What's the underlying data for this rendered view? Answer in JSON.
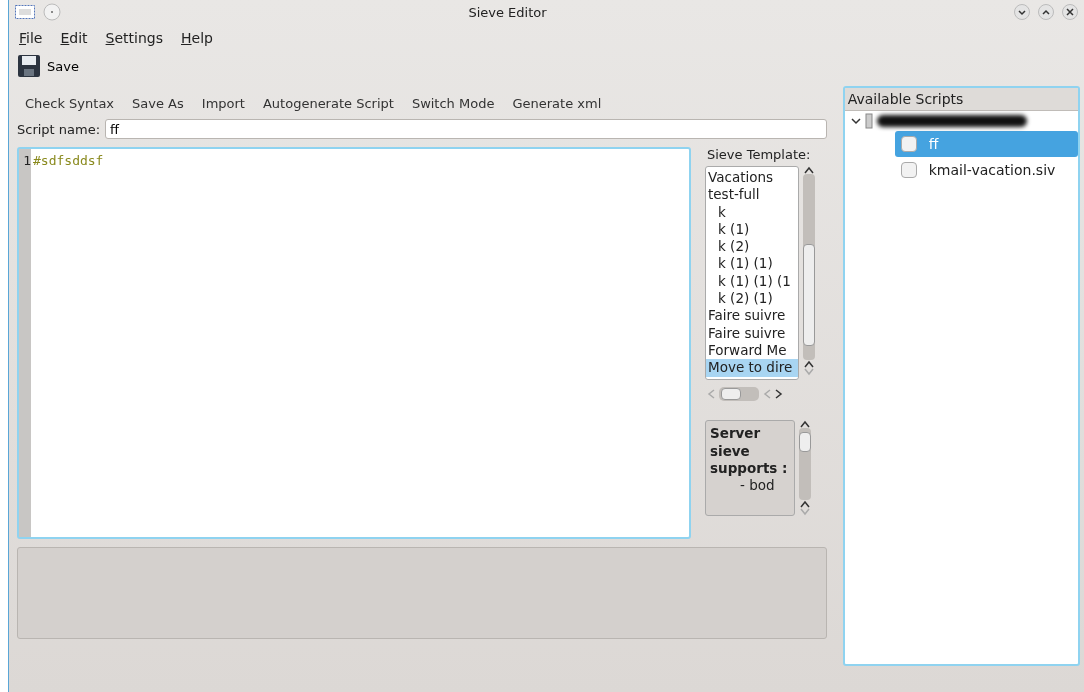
{
  "window": {
    "title": "Sieve Editor"
  },
  "menu": [
    "File",
    "Edit",
    "Settings",
    "Help"
  ],
  "toolbar": [
    {
      "label": "Save"
    }
  ],
  "actions": [
    "Check Syntax",
    "Save As",
    "Import",
    "Autogenerate Script",
    "Switch Mode",
    "Generate xml"
  ],
  "script_name": {
    "label": "Script name:",
    "value": "ff"
  },
  "editor": {
    "lines": [
      {
        "number": "1",
        "text": "#sdfsddsf"
      }
    ]
  },
  "template": {
    "label": "Sieve Template:",
    "items": [
      {
        "label": "Vacations",
        "selected": false
      },
      {
        "label": "test-full",
        "selected": false,
        "children": [
          {
            "label": "k",
            "selected": false
          },
          {
            "label": "k (1)",
            "selected": false
          },
          {
            "label": "k (2)",
            "selected": false
          },
          {
            "label": "k (1) (1)",
            "selected": false
          },
          {
            "label": "k (1) (1) (1",
            "selected": false
          },
          {
            "label": "k (2) (1)",
            "selected": false
          }
        ]
      },
      {
        "label": "Faire suivre",
        "selected": false
      },
      {
        "label": "Faire suivre",
        "selected": false
      },
      {
        "label": "Forward Me",
        "selected": false
      },
      {
        "label": "Move to dire",
        "selected": true
      }
    ]
  },
  "server_info": {
    "heading": "Server sieve supports :",
    "lines": [
      "- bod"
    ]
  },
  "scripts": {
    "header": "Available Scripts",
    "accounts": [
      {
        "expanded": true,
        "children": [
          {
            "label": "ff",
            "selected": true,
            "checked": false
          },
          {
            "label": "kmail-vacation.siv",
            "selected": false,
            "checked": false
          }
        ]
      }
    ]
  }
}
